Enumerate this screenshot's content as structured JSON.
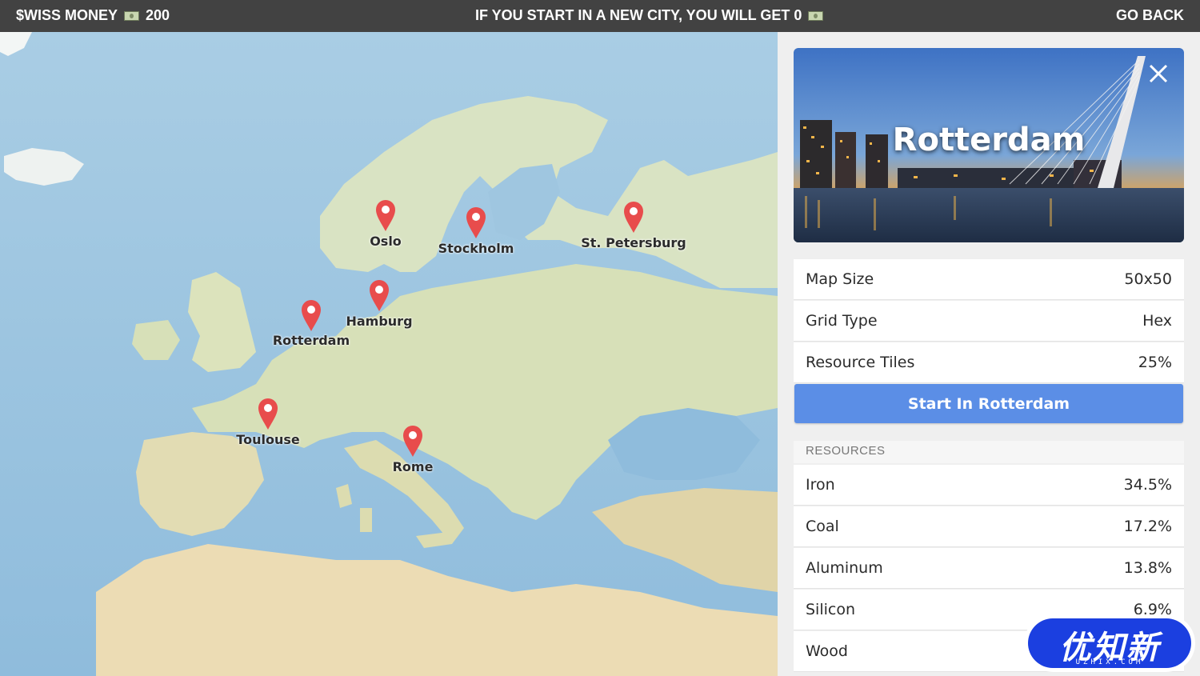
{
  "topbar": {
    "money_label": "$WISS MONEY",
    "money_value": "200",
    "notice": "IF YOU START IN A NEW CITY, YOU WILL GET 0",
    "go_back": "GO BACK",
    "currency_icon": "banknote-icon"
  },
  "map": {
    "cities": [
      {
        "name": "Oslo"
      },
      {
        "name": "Stockholm"
      },
      {
        "name": "St. Petersburg"
      },
      {
        "name": "Hamburg"
      },
      {
        "name": "Rotterdam"
      },
      {
        "name": "Toulouse"
      },
      {
        "name": "Rome"
      }
    ],
    "pin_color": "#e84c4c"
  },
  "panel": {
    "city_title": "Rotterdam",
    "stats": [
      {
        "label": "Map Size",
        "value": "50x50"
      },
      {
        "label": "Grid Type",
        "value": "Hex"
      },
      {
        "label": "Resource Tiles",
        "value": "25%"
      }
    ],
    "start_button": "Start In Rotterdam",
    "resources_header": "RESOURCES",
    "resources": [
      {
        "label": "Iron",
        "value": "34.5%"
      },
      {
        "label": "Coal",
        "value": "17.2%"
      },
      {
        "label": "Aluminum",
        "value": "13.8%"
      },
      {
        "label": "Silicon",
        "value": "6.9%"
      },
      {
        "label": "Wood",
        "value": ""
      }
    ],
    "accent": "#5b8ee6"
  },
  "watermark": {
    "text": "优知新",
    "sub": "UZHIX.COM"
  }
}
